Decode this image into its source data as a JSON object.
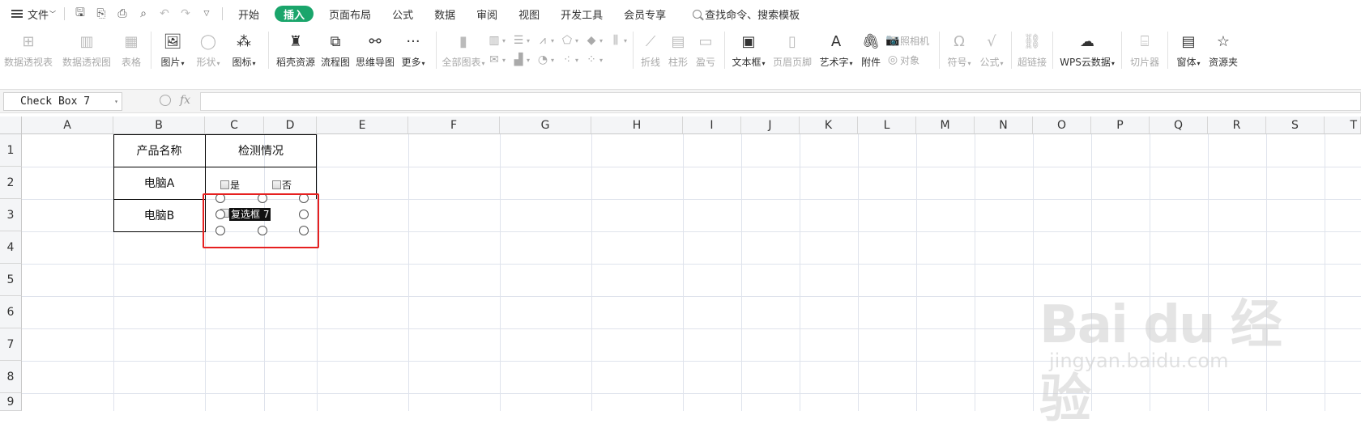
{
  "menu": {
    "file_label": "文件",
    "tabs": [
      "开始",
      "插入",
      "页面布局",
      "公式",
      "数据",
      "审阅",
      "视图",
      "开发工具",
      "会员专享"
    ],
    "active_tab": "插入",
    "search_placeholder": "查找命令、搜索模板",
    "accent_color": "#1aa56b"
  },
  "ribbon": {
    "pivot_table": "数据透视表",
    "pivot_chart": "数据透视图",
    "table": "表格",
    "picture": "图片",
    "shape": "形状",
    "icon": "图标",
    "daoke": "稻壳资源",
    "flowchart": "流程图",
    "mindmap": "思维导图",
    "more": "更多",
    "all_charts": "全部图表",
    "line": "折线",
    "column": "柱形",
    "winloss": "盈亏",
    "textbox": "文本框",
    "header_footer": "页眉页脚",
    "wordart": "艺术字",
    "attachment": "附件",
    "camera": "照相机",
    "object": "对象",
    "symbol": "符号",
    "formula": "公式",
    "hyperlink": "超链接",
    "wps_cloud": "WPS云数据",
    "slicer": "切片器",
    "window": "窗体",
    "resource_folder": "资源夹"
  },
  "formula_bar": {
    "name_box": "Check Box 7",
    "fx": "fx",
    "value": ""
  },
  "grid": {
    "columns": [
      "A",
      "B",
      "C",
      "D",
      "E",
      "F",
      "G",
      "H",
      "I",
      "J",
      "K",
      "L",
      "M",
      "N",
      "O",
      "P",
      "Q",
      "R",
      "S",
      "T"
    ],
    "rows": [
      "1",
      "2",
      "3",
      "4",
      "5",
      "6",
      "7",
      "8",
      "9"
    ]
  },
  "table": {
    "header_name": "产品名称",
    "header_check": "检测情况",
    "row1_name": "电脑A",
    "row2_name": "电脑B",
    "yes_label": "是",
    "no_label": "否",
    "selected_checkbox_label": "复选框 7"
  },
  "watermark": {
    "brand": "Bai du 经验",
    "url": "jingyan.baidu.com"
  }
}
